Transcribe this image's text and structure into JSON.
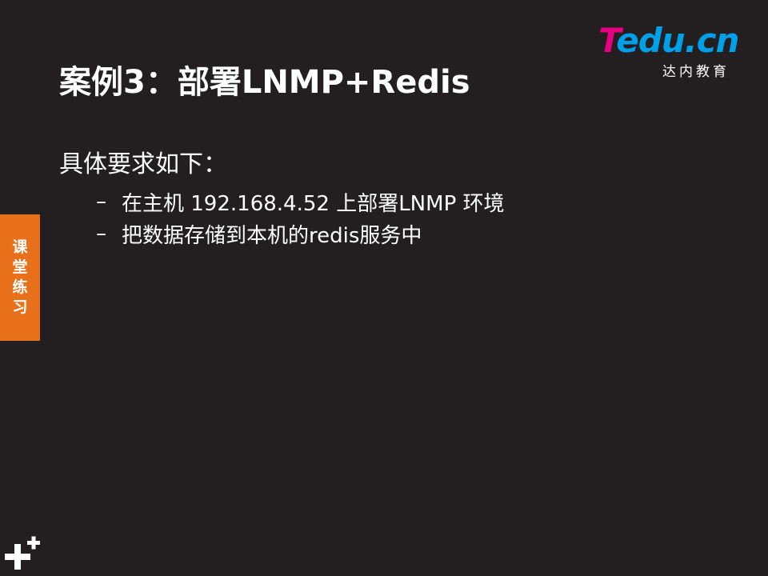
{
  "slide": {
    "title": "案例3：部署LNMP+Redis",
    "intro": "具体要求如下：",
    "bullets": [
      "在主机 192.168.4.52 上部署LNMP 环境",
      "把数据存储到本机的redis服务中"
    ],
    "bullet_marker": "–"
  },
  "logo": {
    "letter_t": "T",
    "rest": "edu.cn",
    "tagline": "达内教育",
    "colors": {
      "t": "#e4007f",
      "rest": "#00a0e9"
    }
  },
  "side_tab": {
    "chars": [
      "课",
      "堂",
      "练",
      "习"
    ],
    "color": "#e8701a"
  },
  "decor": {
    "plus_icon": "plus-icon"
  },
  "colors": {
    "background": "#231f20",
    "text": "#ffffff"
  }
}
